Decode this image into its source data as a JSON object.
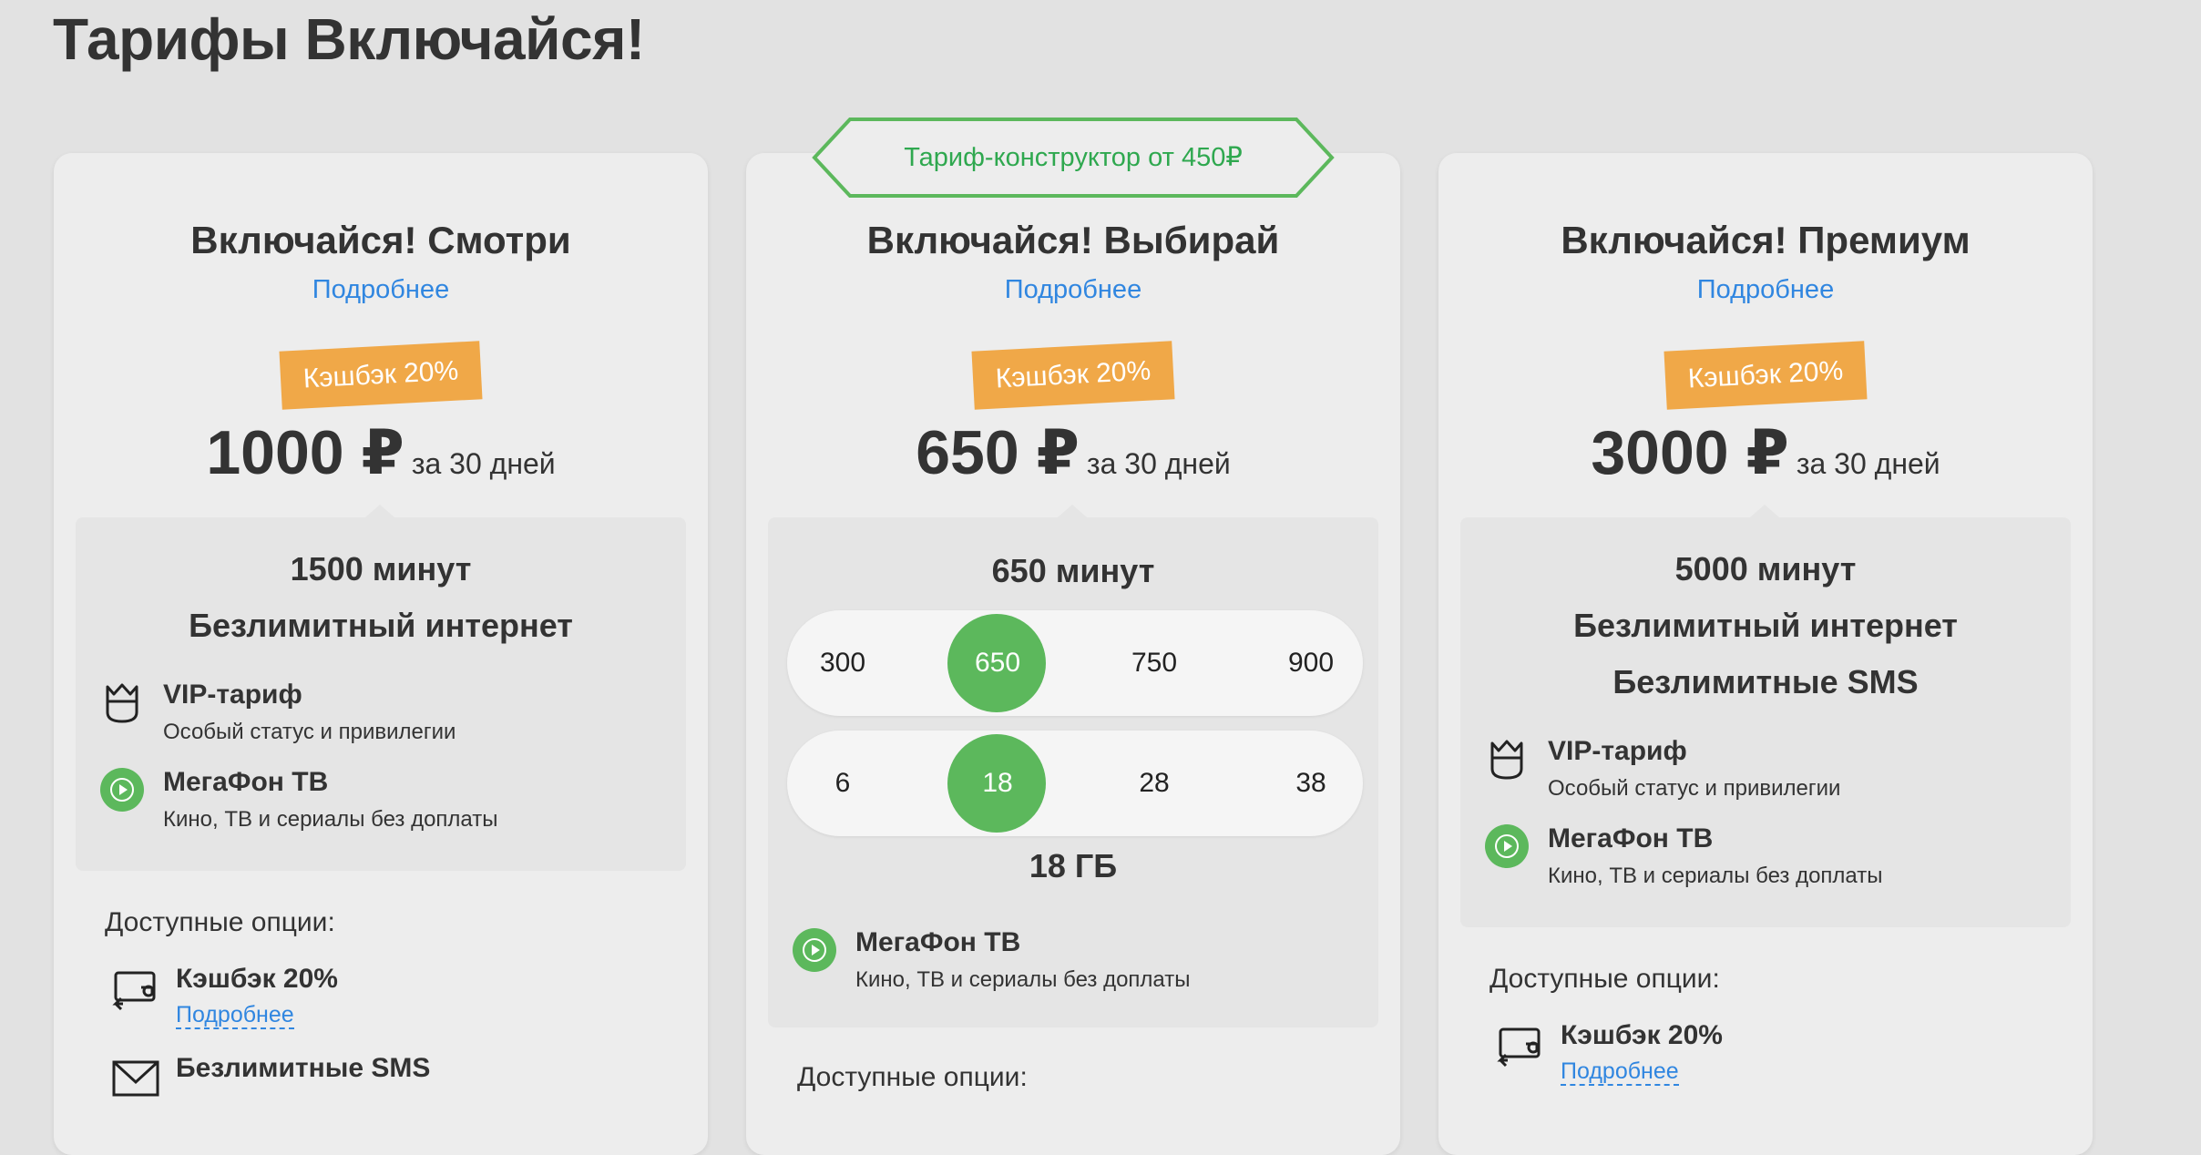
{
  "page": {
    "title": "Тарифы Включайся!"
  },
  "constructor_badge": "Тариф-конструктор от 450₽",
  "colors": {
    "accent_green": "#5cb85c",
    "link_blue": "#3086e0",
    "cashback_orange": "#f0a848"
  },
  "cards": [
    {
      "name": "Включайся! Смотри",
      "details": "Подробнее",
      "cashback": "Кэшбэк 20%",
      "price": "1000 ₽",
      "period": "за 30 дней",
      "features": [
        "1500 минут",
        "Безлимитный интернет"
      ],
      "perks": [
        {
          "icon": "crown-icon",
          "title": "VIP-тариф",
          "subtitle": "Особый статус и привилегии"
        },
        {
          "icon": "tv-play-icon",
          "title": "МегаФон ТВ",
          "subtitle": "Кино, ТВ и сериалы без доплаты"
        }
      ],
      "options_label": "Доступные опции:",
      "options": [
        {
          "icon": "cashback-icon",
          "title": "Кэшбэк 20%",
          "link": "Подробнее"
        },
        {
          "icon": "envelope-icon",
          "title": "Безлимитные SMS"
        }
      ]
    },
    {
      "name": "Включайся! Выбирай",
      "details": "Подробнее",
      "cashback": "Кэшбэк 20%",
      "price": "650 ₽",
      "period": "за 30 дней",
      "minutes_label": "650 минут",
      "minutes_options": [
        "300",
        "650",
        "750",
        "900"
      ],
      "minutes_selected": "650",
      "gb_options": [
        "6",
        "18",
        "28",
        "38"
      ],
      "gb_selected": "18",
      "gb_label": "18 ГБ",
      "perks": [
        {
          "icon": "tv-play-icon",
          "title": "МегаФон ТВ",
          "subtitle": "Кино, ТВ и сериалы без доплаты"
        }
      ],
      "options_label": "Доступные опции:"
    },
    {
      "name": "Включайся! Премиум",
      "details": "Подробнее",
      "cashback": "Кэшбэк 20%",
      "price": "3000 ₽",
      "period": "за 30 дней",
      "features": [
        "5000 минут",
        "Безлимитный интернет",
        "Безлимитные SMS"
      ],
      "perks": [
        {
          "icon": "crown-icon",
          "title": "VIP-тариф",
          "subtitle": "Особый статус и привилегии"
        },
        {
          "icon": "tv-play-icon",
          "title": "МегаФон ТВ",
          "subtitle": "Кино, ТВ и сериалы без доплаты"
        }
      ],
      "options_label": "Доступные опции:",
      "options": [
        {
          "icon": "cashback-icon",
          "title": "Кэшбэк 20%",
          "link": "Подробнее"
        }
      ]
    }
  ]
}
